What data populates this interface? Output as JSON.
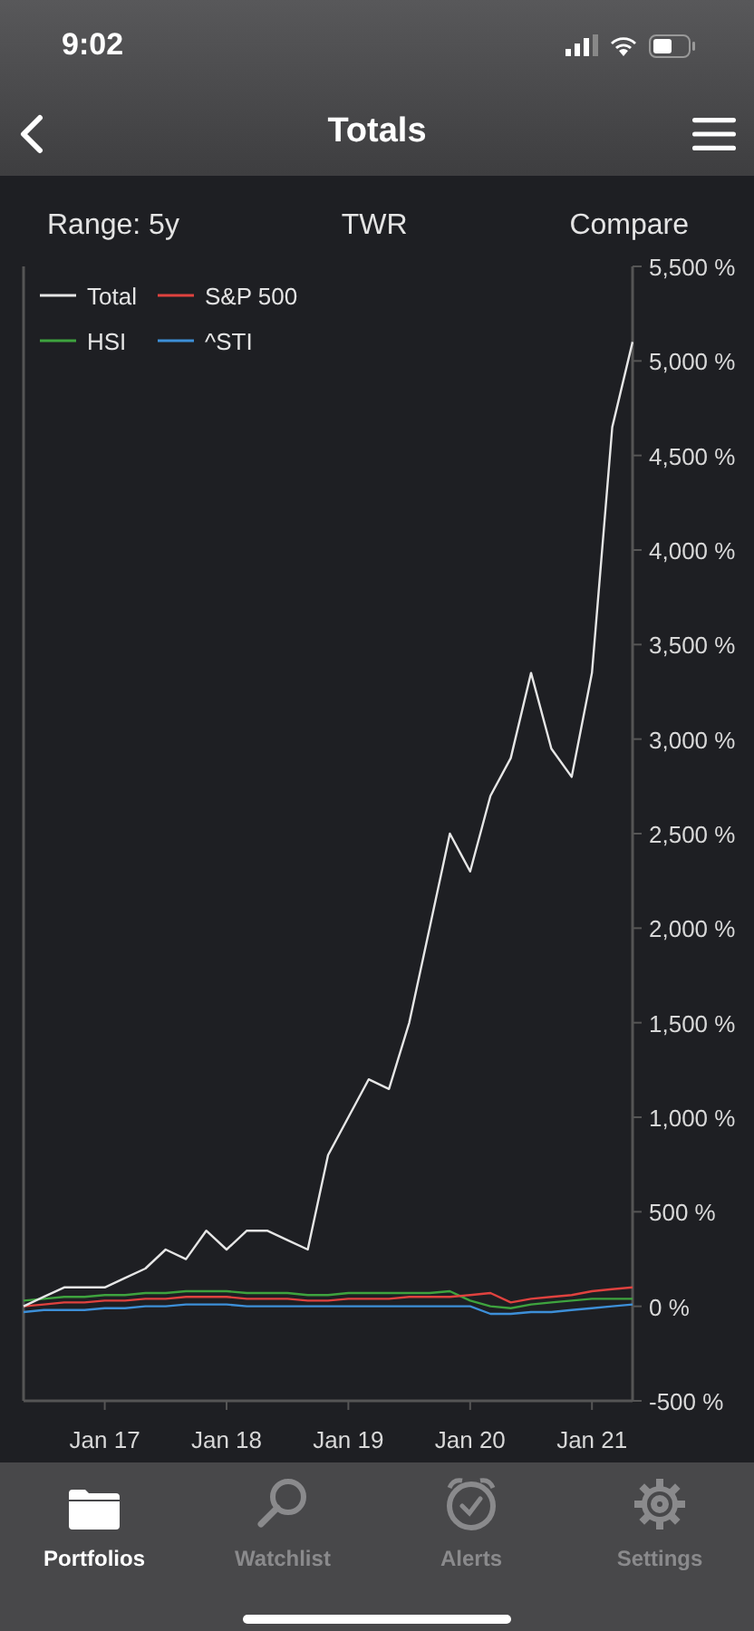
{
  "status_bar": {
    "time": "9:02"
  },
  "nav_bar": {
    "title": "Totals"
  },
  "toolbar": [
    {
      "label": "Range: 5y"
    },
    {
      "label": "TWR"
    },
    {
      "label": "Compare"
    }
  ],
  "chart_data": {
    "type": "line",
    "categories": [
      null,
      null,
      null,
      null,
      "Jan 17",
      null,
      null,
      null,
      null,
      null,
      "Jan 18",
      null,
      null,
      null,
      null,
      null,
      "Jan 19",
      null,
      null,
      null,
      null,
      null,
      "Jan 20",
      null,
      null,
      null,
      null,
      null,
      "Jan 21",
      null,
      null
    ],
    "series": [
      {
        "name": "Total",
        "color": "#e6e6e6",
        "values": [
          0,
          50,
          100,
          100,
          100,
          150,
          200,
          300,
          250,
          400,
          300,
          400,
          400,
          350,
          300,
          800,
          1000,
          1200,
          1150,
          1500,
          2000,
          2500,
          2300,
          2700,
          2900,
          3350,
          2950,
          2800,
          3350,
          4650,
          5100
        ]
      },
      {
        "name": "S&P 500",
        "color": "#e0423f",
        "values": [
          0,
          10,
          20,
          20,
          30,
          30,
          40,
          40,
          50,
          50,
          50,
          40,
          40,
          40,
          30,
          30,
          40,
          40,
          40,
          50,
          50,
          50,
          60,
          70,
          20,
          40,
          50,
          60,
          80,
          90,
          100
        ]
      },
      {
        "name": "HSI",
        "color": "#3ea33e",
        "values": [
          30,
          40,
          50,
          50,
          60,
          60,
          70,
          70,
          80,
          80,
          80,
          70,
          70,
          70,
          60,
          60,
          70,
          70,
          70,
          70,
          70,
          80,
          30,
          0,
          -10,
          10,
          20,
          30,
          40,
          40,
          40
        ]
      },
      {
        "name": "^STI",
        "color": "#3d8fd8",
        "values": [
          -30,
          -20,
          -20,
          -20,
          -10,
          -10,
          0,
          0,
          10,
          10,
          10,
          0,
          0,
          0,
          0,
          0,
          0,
          0,
          0,
          0,
          0,
          0,
          0,
          -40,
          -40,
          -30,
          -30,
          -20,
          -10,
          0,
          10
        ]
      }
    ],
    "legend": true,
    "ylim": [
      -500,
      5500
    ],
    "yticks": [
      {
        "value": 5500,
        "label": "5,500 %"
      },
      {
        "value": 5000,
        "label": "5,000 %"
      },
      {
        "value": 4500,
        "label": "4,500 %"
      },
      {
        "value": 4000,
        "label": "4,000 %"
      },
      {
        "value": 3500,
        "label": "3,500 %"
      },
      {
        "value": 3000,
        "label": "3,000 %"
      },
      {
        "value": 2500,
        "label": "2,500 %"
      },
      {
        "value": 2000,
        "label": "2,000 %"
      },
      {
        "value": 1500,
        "label": "1,500 %"
      },
      {
        "value": 1000,
        "label": "1,000 %"
      },
      {
        "value": 500,
        "label": "500 %"
      },
      {
        "value": 0,
        "label": "0 %"
      },
      {
        "value": -500,
        "label": "-500 %"
      }
    ]
  },
  "tab_bar": [
    {
      "label": "Portfolios",
      "kind": "folder",
      "selected": true
    },
    {
      "label": "Watchlist",
      "kind": "search",
      "selected": false
    },
    {
      "label": "Alerts",
      "kind": "alarm",
      "selected": false
    },
    {
      "label": "Settings",
      "kind": "gear",
      "selected": false
    }
  ]
}
